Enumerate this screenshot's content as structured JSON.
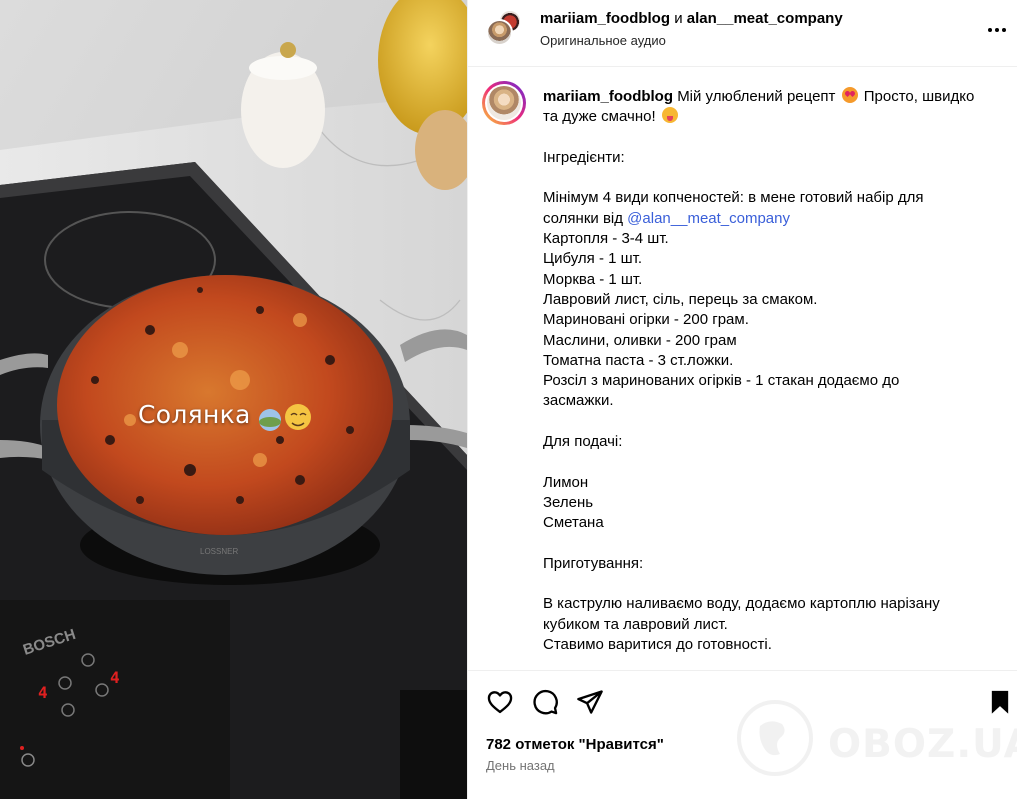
{
  "media": {
    "overlay_text": "Солянка",
    "brand": "BOSCH",
    "pot_brand": "LOSSNER",
    "stove_digits": [
      "4",
      "4"
    ]
  },
  "header": {
    "user1": "mariiam_foodblog",
    "conj": "и",
    "user2": "alan__meat_company",
    "audio": "Оригинальное аудио"
  },
  "caption": {
    "username": "mariiam_foodblog",
    "first_line": "Мій улюблений рецепт",
    "first_line_2": "Просто, швидко",
    "line2": "та дуже смачно!",
    "ingredients_title": "Інгредієнти:",
    "smoked_line1": "Мінімум 4 види копченостей: в мене готовий набір для",
    "smoked_line2_pre": "солянки від ",
    "mention": "@alan__meat_company",
    "items": [
      "Картопля - 3-4 шт.",
      "Цибуля - 1 шт.",
      "Морква - 1 шт.",
      "Лавровий лист, сіль, перець за смаком.",
      "Мариновані огірки - 200 грам.",
      "Маслини, оливки - 200 грам",
      "Томатна паста - 3 ст.ложки.",
      "Розсіл з маринованих огірків - 1 стакан додаємо до",
      "засмажки."
    ],
    "serving_title": "Для подачі:",
    "serving": [
      "Лимон",
      "Зелень",
      "Сметана"
    ],
    "prep_title": "Приготування:",
    "prep": [
      "В каструлю наливаємо воду, додаємо картоплю нарізану",
      "кубиком та лавровий лист.",
      "Ставимо варитися до готовності."
    ]
  },
  "actions": {
    "likes": "782 отметок \"Нравится\"",
    "time": "День назад"
  },
  "watermark": {
    "text": "OBOZ.UA"
  },
  "colors": {
    "mention": "#3a5fd9",
    "muted": "#737373",
    "divider": "#efefef"
  }
}
